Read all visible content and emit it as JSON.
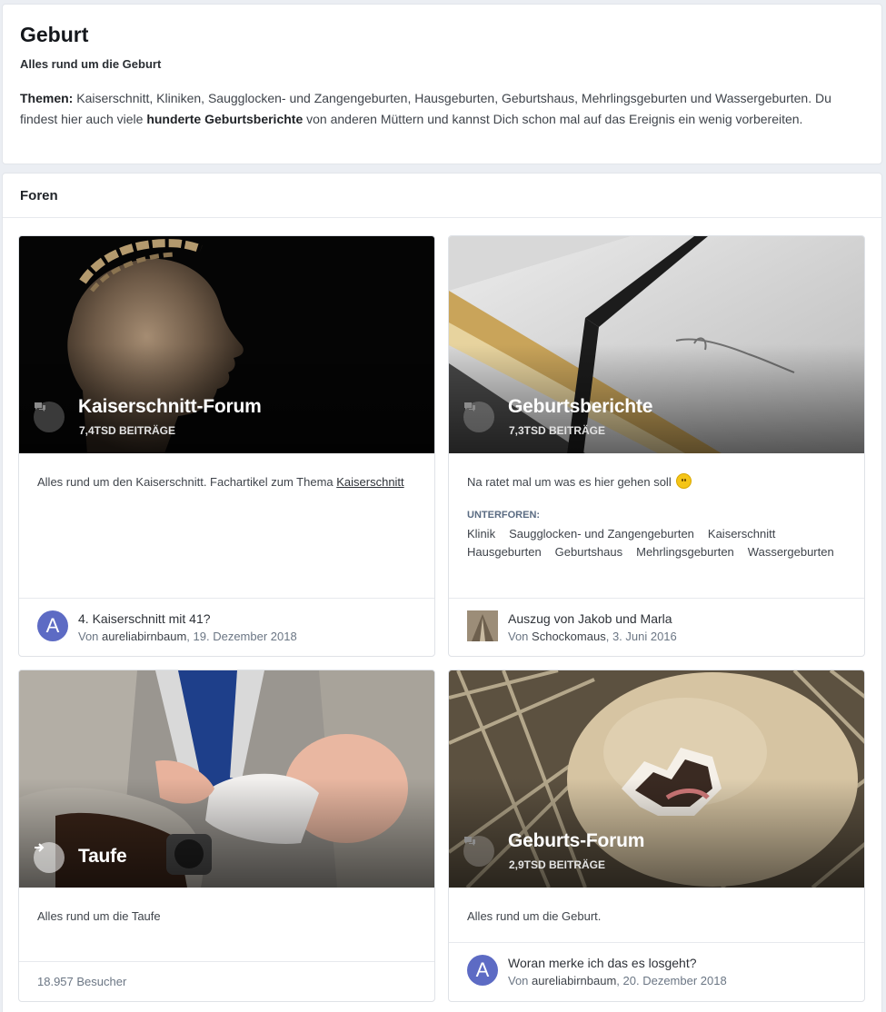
{
  "header": {
    "title": "Geburt",
    "subtitle": "Alles rund um die Geburt",
    "themes_label": "Themen:",
    "themes_text": " Kaiserschnitt, Kliniken, Saugglocken- und Zangengeburten, Hausgeburten, Geburtshaus, Mehrlingsgeburten und Wassergeburten. Du findest hier auch viele ",
    "highlight": "hunderte Geburtsberichte",
    "rest_text": " von anderen Müttern und kannst Dich schon mal auf das Ereignis ein wenig vorbereiten."
  },
  "forums_title": "Foren",
  "forums": [
    {
      "title": "Kaiserschnitt-Forum",
      "count": "7,4tsd Beiträge",
      "desc_text": "Alles rund um den Kaiserschnitt. Fachartikel zum Thema ",
      "desc_link": "Kaiserschnitt",
      "icon": "speech-bubbles-icon",
      "last_post": {
        "title": "4. Kaiserschnitt mit 41?",
        "by": "Von",
        "user": "aureliabirnbaum",
        "date": "19. Dezember 2018",
        "avatar_letter": "A"
      }
    },
    {
      "title": "Geburtsberichte",
      "count": "7,3tsd Beiträge",
      "desc_text": "Na ratet mal um was es hier gehen soll",
      "icon": "speech-bubbles-icon",
      "subforums_label": "Unterforen:",
      "subforums": [
        "Klinik",
        "Saugglocken- und Zangengeburten",
        "Kaiserschnitt",
        "Hausgeburten",
        "Geburtshaus",
        "Mehrlingsgeburten",
        "Wassergeburten"
      ],
      "last_post": {
        "title": "Auszug von Jakob und Marla",
        "by": "Von",
        "user": "Schockomaus",
        "date": "3. Juni 2016"
      }
    },
    {
      "title": "Taufe",
      "desc_text": "Alles rund um die Taufe",
      "icon": "arrow-right-icon",
      "visitors": "18.957 Besucher"
    },
    {
      "title": "Geburts-Forum",
      "count": "2,9tsd Beiträge",
      "desc_text": "Alles rund um die Geburt.",
      "icon": "speech-bubbles-icon",
      "last_post": {
        "title": "Woran merke ich das es losgeht?",
        "by": "Von",
        "user": "aureliabirnbaum",
        "date": "20. Dezember 2018",
        "avatar_letter": "A"
      }
    }
  ],
  "colors": {
    "avatar": "#5d6bc4",
    "subforum_label": "#5a6b82",
    "meta": "#6b7684"
  }
}
